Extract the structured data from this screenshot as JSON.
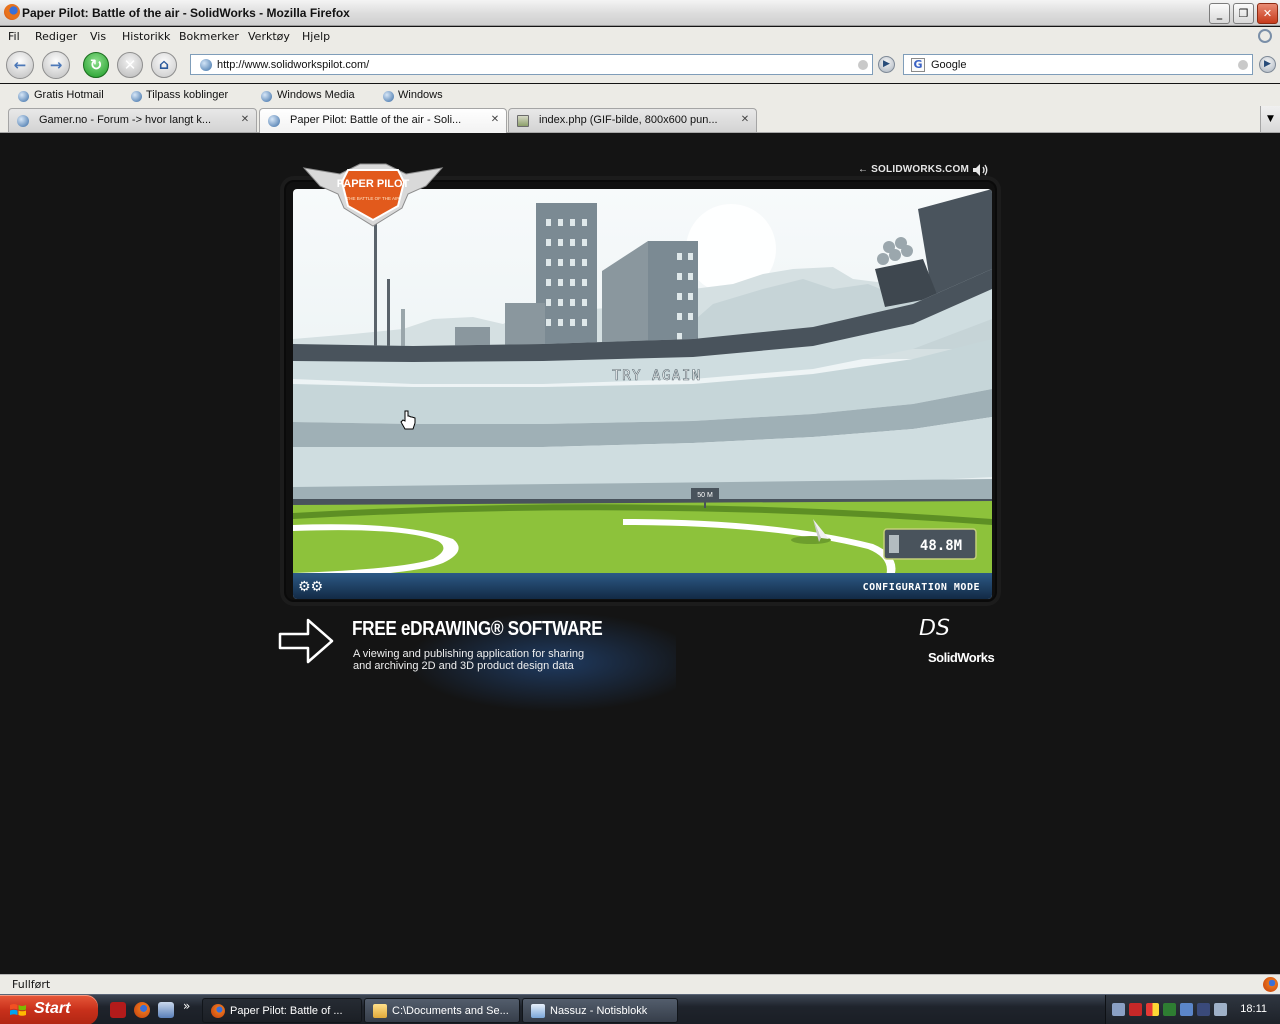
{
  "window": {
    "title": "Paper Pilot: Battle of the air - SolidWorks - Mozilla Firefox",
    "minimize": "_",
    "maximize": "❐",
    "close": "✕"
  },
  "menu": [
    "Fil",
    "Rediger",
    "Vis",
    "Historikk",
    "Bokmerker",
    "Verktøy",
    "Hjelp"
  ],
  "toolbar": {
    "url": "http://www.solidworkspilot.com/",
    "search_engine_icon": "G",
    "search_value": "Google"
  },
  "bookmarks": [
    "Gratis Hotmail",
    "Tilpass koblinger",
    "Windows Media",
    "Windows"
  ],
  "tabs": [
    {
      "label": "Gamer.no - Forum -> hvor langt k...",
      "active": false
    },
    {
      "label": "Paper Pilot: Battle of the air - Soli...",
      "active": true
    },
    {
      "label": "index.php (GIF-bilde, 800x600 pun...",
      "active": false
    }
  ],
  "page": {
    "logo_text": "PAPER PILOT",
    "logo_sub": "THE BATTLE OF THE AIR",
    "nav_link": "← SOLIDWORKS.COM",
    "game": {
      "message": "TRY AGAIN",
      "marker": "50 M",
      "distance": "48.8M",
      "config_mode": "CONFIGURATION MODE"
    },
    "promo": {
      "headline": "FREE eDRAWING® SOFTWARE",
      "line1": "A viewing and publishing application for sharing",
      "line2": "and archiving 2D and 3D product design data"
    },
    "brand": {
      "ds": "𝘋𝘚",
      "name": "SolidWorks"
    }
  },
  "status": {
    "text": "Fullført"
  },
  "taskbar": {
    "start": "Start",
    "ql_more": "»",
    "buttons": [
      {
        "label": "Paper Pilot: Battle of ...",
        "active": true
      },
      {
        "label": "C:\\Documents and Se...",
        "active": false
      },
      {
        "label": "Nassuz - Notisblokk",
        "active": false
      }
    ],
    "clock": "18:11"
  },
  "colors": {
    "page_bg": "#141414",
    "sky": "#eef3f5",
    "stadium_dark": "#49535c",
    "stadium_light": "#cfdde0",
    "grass": "#8dc23b",
    "config_bar": "#1d3a5c",
    "taskbar_start": "#c8301b"
  }
}
